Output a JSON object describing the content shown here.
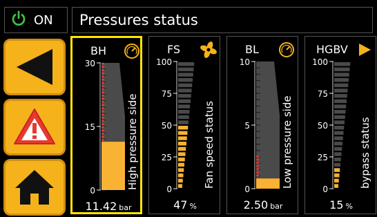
{
  "power": {
    "label": "ON",
    "color": "#3fbf3f",
    "icon": "power-icon"
  },
  "header": {
    "title": "Pressures status"
  },
  "nav": [
    {
      "name": "back-button",
      "icon": "left-triangle-icon"
    },
    {
      "name": "alarm-button",
      "icon": "warning-icon"
    },
    {
      "name": "home-button",
      "icon": "home-icon"
    }
  ],
  "colors": {
    "accent": "#f6b21b",
    "fill": "#f9b233",
    "track": "#4a4a4a",
    "danger": "#e53a2f",
    "selected": "#ffe600"
  },
  "gauges": [
    {
      "id": "bh",
      "code": "BH",
      "icon": "gauge-icon",
      "label": "High pressure side",
      "max": 30,
      "ticks": [
        "30",
        "15",
        "0"
      ],
      "value_text": "11.42",
      "unit": "bar",
      "fraction": 0.38,
      "style": "solid",
      "red_marks": true
    },
    {
      "id": "fs",
      "code": "FS",
      "icon": "fan-icon",
      "label": "Fan speed status",
      "max": 100,
      "ticks": [
        "100",
        "75",
        "50",
        "25",
        "0"
      ],
      "value_text": "47",
      "unit": "%",
      "fraction": 0.47,
      "style": "wedge",
      "red_marks": false
    },
    {
      "id": "bl",
      "code": "BL",
      "icon": "gauge-icon",
      "label": "Low pressure side",
      "max": 10,
      "ticks": [
        "10",
        "5",
        "0"
      ],
      "value_text": "2.50",
      "unit": "bar",
      "fraction": 0.08,
      "style": "solid",
      "red_marks": true
    },
    {
      "id": "hgbv",
      "code": "HGBV",
      "icon": "valve-icon",
      "label": "bypass status",
      "max": 100,
      "ticks": [
        "100",
        "75",
        "50",
        "25",
        "0"
      ],
      "value_text": "15",
      "unit": "%",
      "fraction": 0.15,
      "style": "wedge",
      "red_marks": false
    }
  ]
}
